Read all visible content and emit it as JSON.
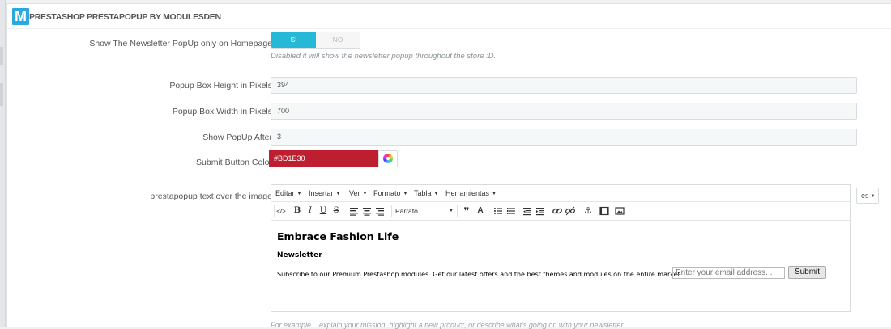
{
  "panel": {
    "logo_letter": "M",
    "title": "PRESTASHOP PRESTAPOPUP BY MODULESDEN"
  },
  "fields": {
    "homepage_only": {
      "label": "Show The Newsletter PopUp only on Homepage",
      "yes": "SÍ",
      "no": "NO",
      "help": "Disabled it will show the newsletter popup throughout the store :D."
    },
    "height": {
      "label": "Popup Box Height in Pixels",
      "value": "394"
    },
    "width": {
      "label": "Popup Box Width in Pixels",
      "value": "700"
    },
    "after": {
      "label": "Show PopUp After",
      "value": "3"
    },
    "button_color": {
      "label": "Submit Button Color",
      "value": "#BD1E30",
      "color": "#bd1e30"
    },
    "text_over_image": {
      "label": "prestapopup text over the image"
    }
  },
  "editor": {
    "menu": [
      "Editar",
      "Insertar",
      "Ver",
      "Formato",
      "Tabla",
      "Herramientas"
    ],
    "format_select": "Párrafo",
    "content": {
      "heading": "Embrace Fashion Life",
      "subheading": "Newsletter",
      "text": "Subscribe to our Premium Prestashop modules. Get our latest offers and the best themes and modules on the entire market.",
      "email_placeholder": "Enter your email address...",
      "submit": "Submit"
    }
  },
  "lang": "es",
  "bottom_help": "For example... explain your mission, highlight a new product, or describe what's going on with your newsletter"
}
